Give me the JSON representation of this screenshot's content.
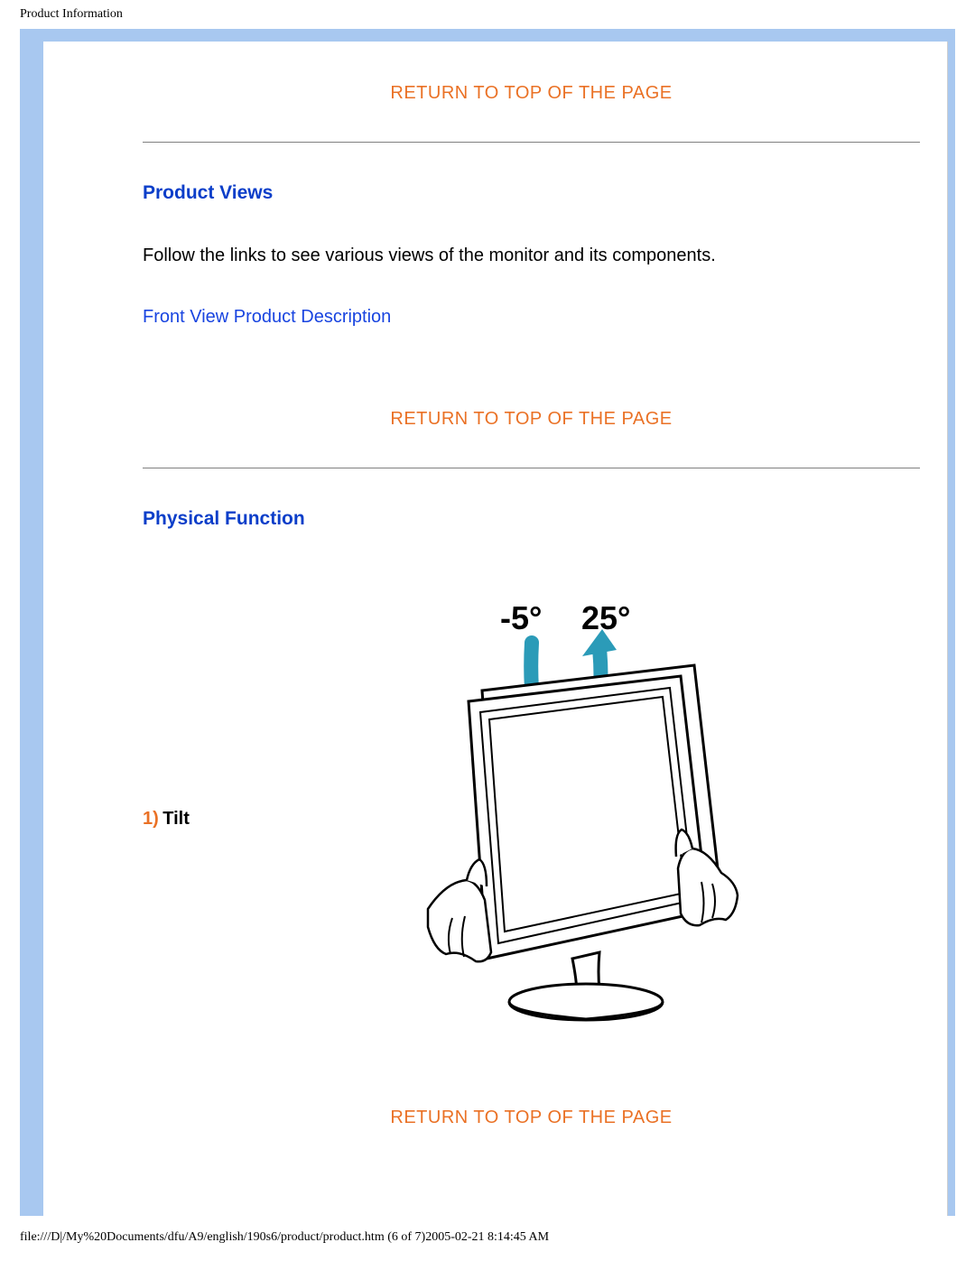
{
  "page_header": "Product Information",
  "return_link_label": "RETURN TO TOP OF THE PAGE",
  "sections": {
    "product_views": {
      "heading": "Product Views",
      "body": "Follow the links to see various views of the monitor and its components.",
      "link": "Front View Product Description"
    },
    "physical_function": {
      "heading": "Physical Function",
      "item_number": "1)",
      "item_label": "Tilt",
      "tilt_min": "-5°",
      "tilt_max": "25°"
    }
  },
  "footer": "file:///D|/My%20Documents/dfu/A9/english/190s6/product/product.htm (6 of 7)2005-02-21 8:14:45 AM"
}
